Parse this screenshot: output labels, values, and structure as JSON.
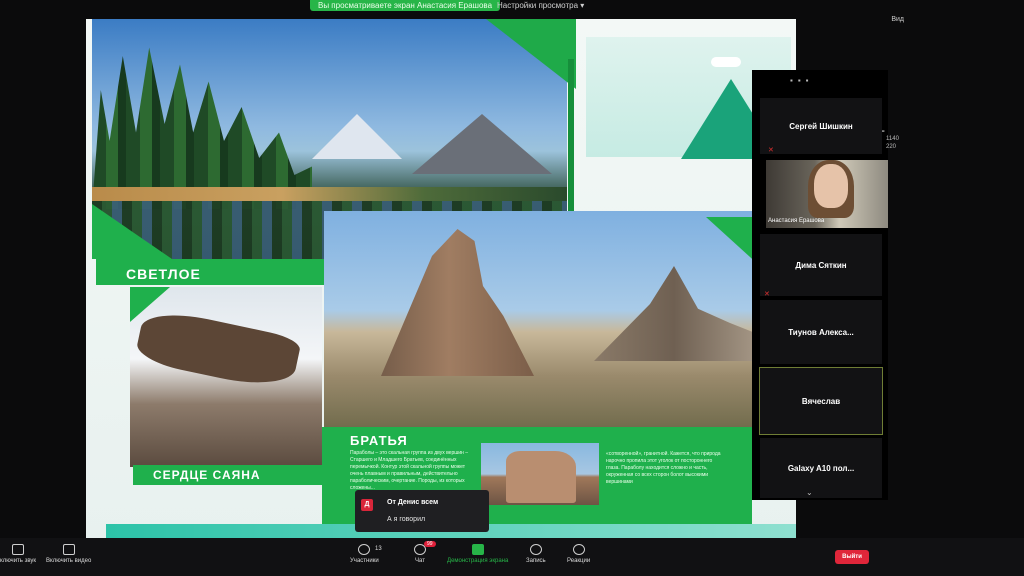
{
  "top": {
    "share_banner": "Вы просматриваете экран Анастасия Ерашова",
    "view_settings": "Настройки просмотра ▾",
    "top_right": "Вид"
  },
  "slide": {
    "label_1": "СВЕТЛОЕ",
    "label_2": "СЕРДЦЕ САЯНА",
    "label_3": "БРАТЬЯ",
    "text_left": "Параболы – это скальная группа из двух вершин – Старшего и Младшего Братьев, соединённых перемычкой. Контур этой скальной группы может очень плавным и правильным, действительно параболическим, очертание. Породы, из которых сложены...",
    "text_right": "«сотворенной», гранитной. Кажется, что природа нарочно пропила этот уголок от постороннего глаза. Параболу находится сложно и часть, окруженная со всех сторон болот высокими вершинами"
  },
  "chat": {
    "avatar_letter": "Д",
    "from": "От Денис всем",
    "message": "А я говорил"
  },
  "participants": [
    {
      "name": "Сергей Шишкин",
      "mic_muted": false
    },
    {
      "name": "Анастасия Ерашова",
      "mic_muted": true,
      "video": true
    },
    {
      "name": "Дима Сяткин",
      "mic_muted": false
    },
    {
      "name": "Тиунов  Алекса...",
      "mic_muted": true
    },
    {
      "name": "Вячеслав",
      "mic_muted": false,
      "active": true
    },
    {
      "name": "Galaxy A10 пол...",
      "mic_muted": false
    }
  ],
  "panel_meta": {
    "line1": "1140",
    "line2": "220"
  },
  "toolbar": {
    "mic_label": "ключить звук",
    "video_label": "Включить видео",
    "participants_label": "Участники",
    "participants_count": "13",
    "chat_label": "Чат",
    "chat_badge": "99",
    "share_label": "Демонстрация экрана",
    "record_label": "Запись",
    "reactions_label": "Реакции",
    "leave_label": "Выйти"
  },
  "colors": {
    "accent_green": "#1fb04c",
    "leave_red": "#e0263a",
    "mic_off_red": "#e03030"
  }
}
